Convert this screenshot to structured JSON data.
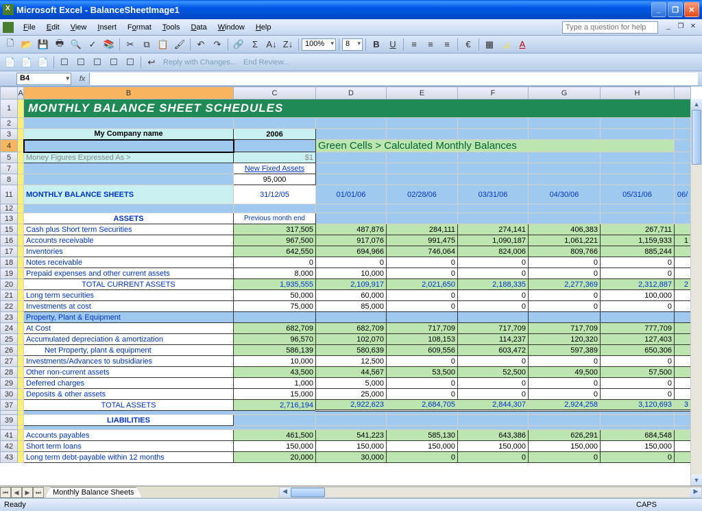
{
  "titlebar": {
    "title": "Microsoft Excel - BalanceSheetImage1"
  },
  "menu": {
    "file": "File",
    "edit": "Edit",
    "view": "View",
    "insert": "Insert",
    "format": "Format",
    "tools": "Tools",
    "data": "Data",
    "window": "Window",
    "help": "Help",
    "help_placeholder": "Type a question for help"
  },
  "toolbar1": {
    "zoom": "100%",
    "fontsize": "8",
    "euro": "€"
  },
  "toolbar2": {
    "reply": "Reply with Changes...",
    "end": "End Review..."
  },
  "namebox": "B4",
  "sheet": {
    "title": "MONTHLY BALANCE SHEET SCHEDULES",
    "company": "My Company name",
    "year": "2006",
    "banner": "Green Cells > Calculated Monthly Balances",
    "money_label": "Money Figures Expressed As >",
    "money_val": "$1",
    "new_fixed": "New Fixed Assets",
    "new_fixed_val": "95,000",
    "mbs": "MONTHLY BALANCE SHEETS",
    "prev": "Previous month end",
    "assets": "ASSETS",
    "liabilities": "LIABILITIES",
    "dates": [
      "31/12/05",
      "01/01/06",
      "02/28/06",
      "03/31/06",
      "04/30/06",
      "05/31/06",
      "06/"
    ],
    "rows": [
      {
        "label": "Cash plus Short term Securities",
        "green": true,
        "vals": [
          "317,505",
          "487,876",
          "284,111",
          "274,141",
          "406,383",
          "267,711",
          ""
        ]
      },
      {
        "label": "Accounts receivable",
        "green": true,
        "vals": [
          "967,500",
          "917,076",
          "991,475",
          "1,090,187",
          "1,061,221",
          "1,159,933",
          "1"
        ]
      },
      {
        "label": "Inventories",
        "green": true,
        "vals": [
          "642,550",
          "694,966",
          "746,064",
          "824,006",
          "809,766",
          "885,244",
          ""
        ]
      },
      {
        "label": "Notes receivable",
        "green": false,
        "vals": [
          "0",
          "0",
          "0",
          "0",
          "0",
          "0",
          ""
        ]
      },
      {
        "label": "Prepaid expenses and other current assets",
        "green": false,
        "vals": [
          "8,000",
          "10,000",
          "0",
          "0",
          "0",
          "0",
          ""
        ]
      },
      {
        "label": "TOTAL CURRENT ASSETS",
        "green": true,
        "total": true,
        "vals": [
          "1,935,555",
          "2,109,917",
          "2,021,650",
          "2,188,335",
          "2,277,369",
          "2,312,887",
          "2"
        ]
      },
      {
        "label": "Long term securities",
        "green": false,
        "vals": [
          "50,000",
          "60,000",
          "0",
          "0",
          "0",
          "100,000",
          ""
        ]
      },
      {
        "label": "Investments at cost",
        "green": false,
        "vals": [
          "75,000",
          "85,000",
          "0",
          "0",
          "0",
          "0",
          ""
        ]
      },
      {
        "label": "Property, Plant & Equipment",
        "blue": true,
        "vals": [
          "",
          "",
          "",
          "",
          "",
          "",
          ""
        ]
      },
      {
        "label": "At Cost",
        "green": true,
        "vals": [
          "682,709",
          "682,709",
          "717,709",
          "717,709",
          "717,709",
          "777,709",
          ""
        ]
      },
      {
        "label": "Accumulated depreciation & amortization",
        "green": true,
        "vals": [
          "96,570",
          "102,070",
          "108,153",
          "114,237",
          "120,320",
          "127,403",
          ""
        ]
      },
      {
        "label": "Net Property, plant & equipment",
        "green": true,
        "indent": true,
        "vals": [
          "586,139",
          "580,639",
          "609,556",
          "603,472",
          "597,389",
          "650,306",
          ""
        ]
      },
      {
        "label": "Investments/Advances to subsidiaries",
        "green": false,
        "vals": [
          "10,000",
          "12,500",
          "0",
          "0",
          "0",
          "0",
          ""
        ]
      },
      {
        "label": "Other non-current assets",
        "green": true,
        "vals": [
          "43,500",
          "44,567",
          "53,500",
          "52,500",
          "49,500",
          "57,500",
          ""
        ]
      },
      {
        "label": "Deferred charges",
        "green": false,
        "vals": [
          "1,000",
          "5,000",
          "0",
          "0",
          "0",
          "0",
          ""
        ]
      },
      {
        "label": "Deposits & other assets",
        "green": false,
        "vals": [
          "15,000",
          "25,000",
          "0",
          "0",
          "0",
          "0",
          ""
        ]
      },
      {
        "label": "TOTAL ASSETS",
        "green": true,
        "total": true,
        "double": true,
        "vals": [
          "2,716,194",
          "2,922,623",
          "2,684,705",
          "2,844,307",
          "2,924,258",
          "3,120,693",
          "3"
        ]
      }
    ],
    "liab_rows": [
      {
        "label": "Accounts payables",
        "green": true,
        "vals": [
          "461,500",
          "541,223",
          "585,130",
          "643,386",
          "626,291",
          "684,548",
          ""
        ]
      },
      {
        "label": "Short term loans",
        "green": false,
        "vals": [
          "150,000",
          "150,000",
          "150,000",
          "150,000",
          "150,000",
          "150,000",
          ""
        ]
      },
      {
        "label": "Long term debt-payable within 12 months",
        "green": true,
        "vals": [
          "20,000",
          "30,000",
          "0",
          "0",
          "0",
          "0",
          ""
        ]
      }
    ]
  },
  "col_headers": [
    "",
    "A",
    "B",
    "C",
    "D",
    "E",
    "F",
    "G",
    "H",
    ""
  ],
  "row_numbers": [
    "1",
    "2",
    "3",
    "4",
    "5",
    "7",
    "8",
    "11",
    "12",
    "13",
    "15",
    "16",
    "17",
    "18",
    "19",
    "20",
    "21",
    "22",
    "23",
    "24",
    "25",
    "26",
    "27",
    "28",
    "29",
    "30",
    "37",
    "39",
    "41",
    "42",
    "43"
  ],
  "tabs": {
    "sheet1": "Monthly Balance Sheets"
  },
  "statusbar": {
    "ready": "Ready",
    "caps": "CAPS"
  }
}
